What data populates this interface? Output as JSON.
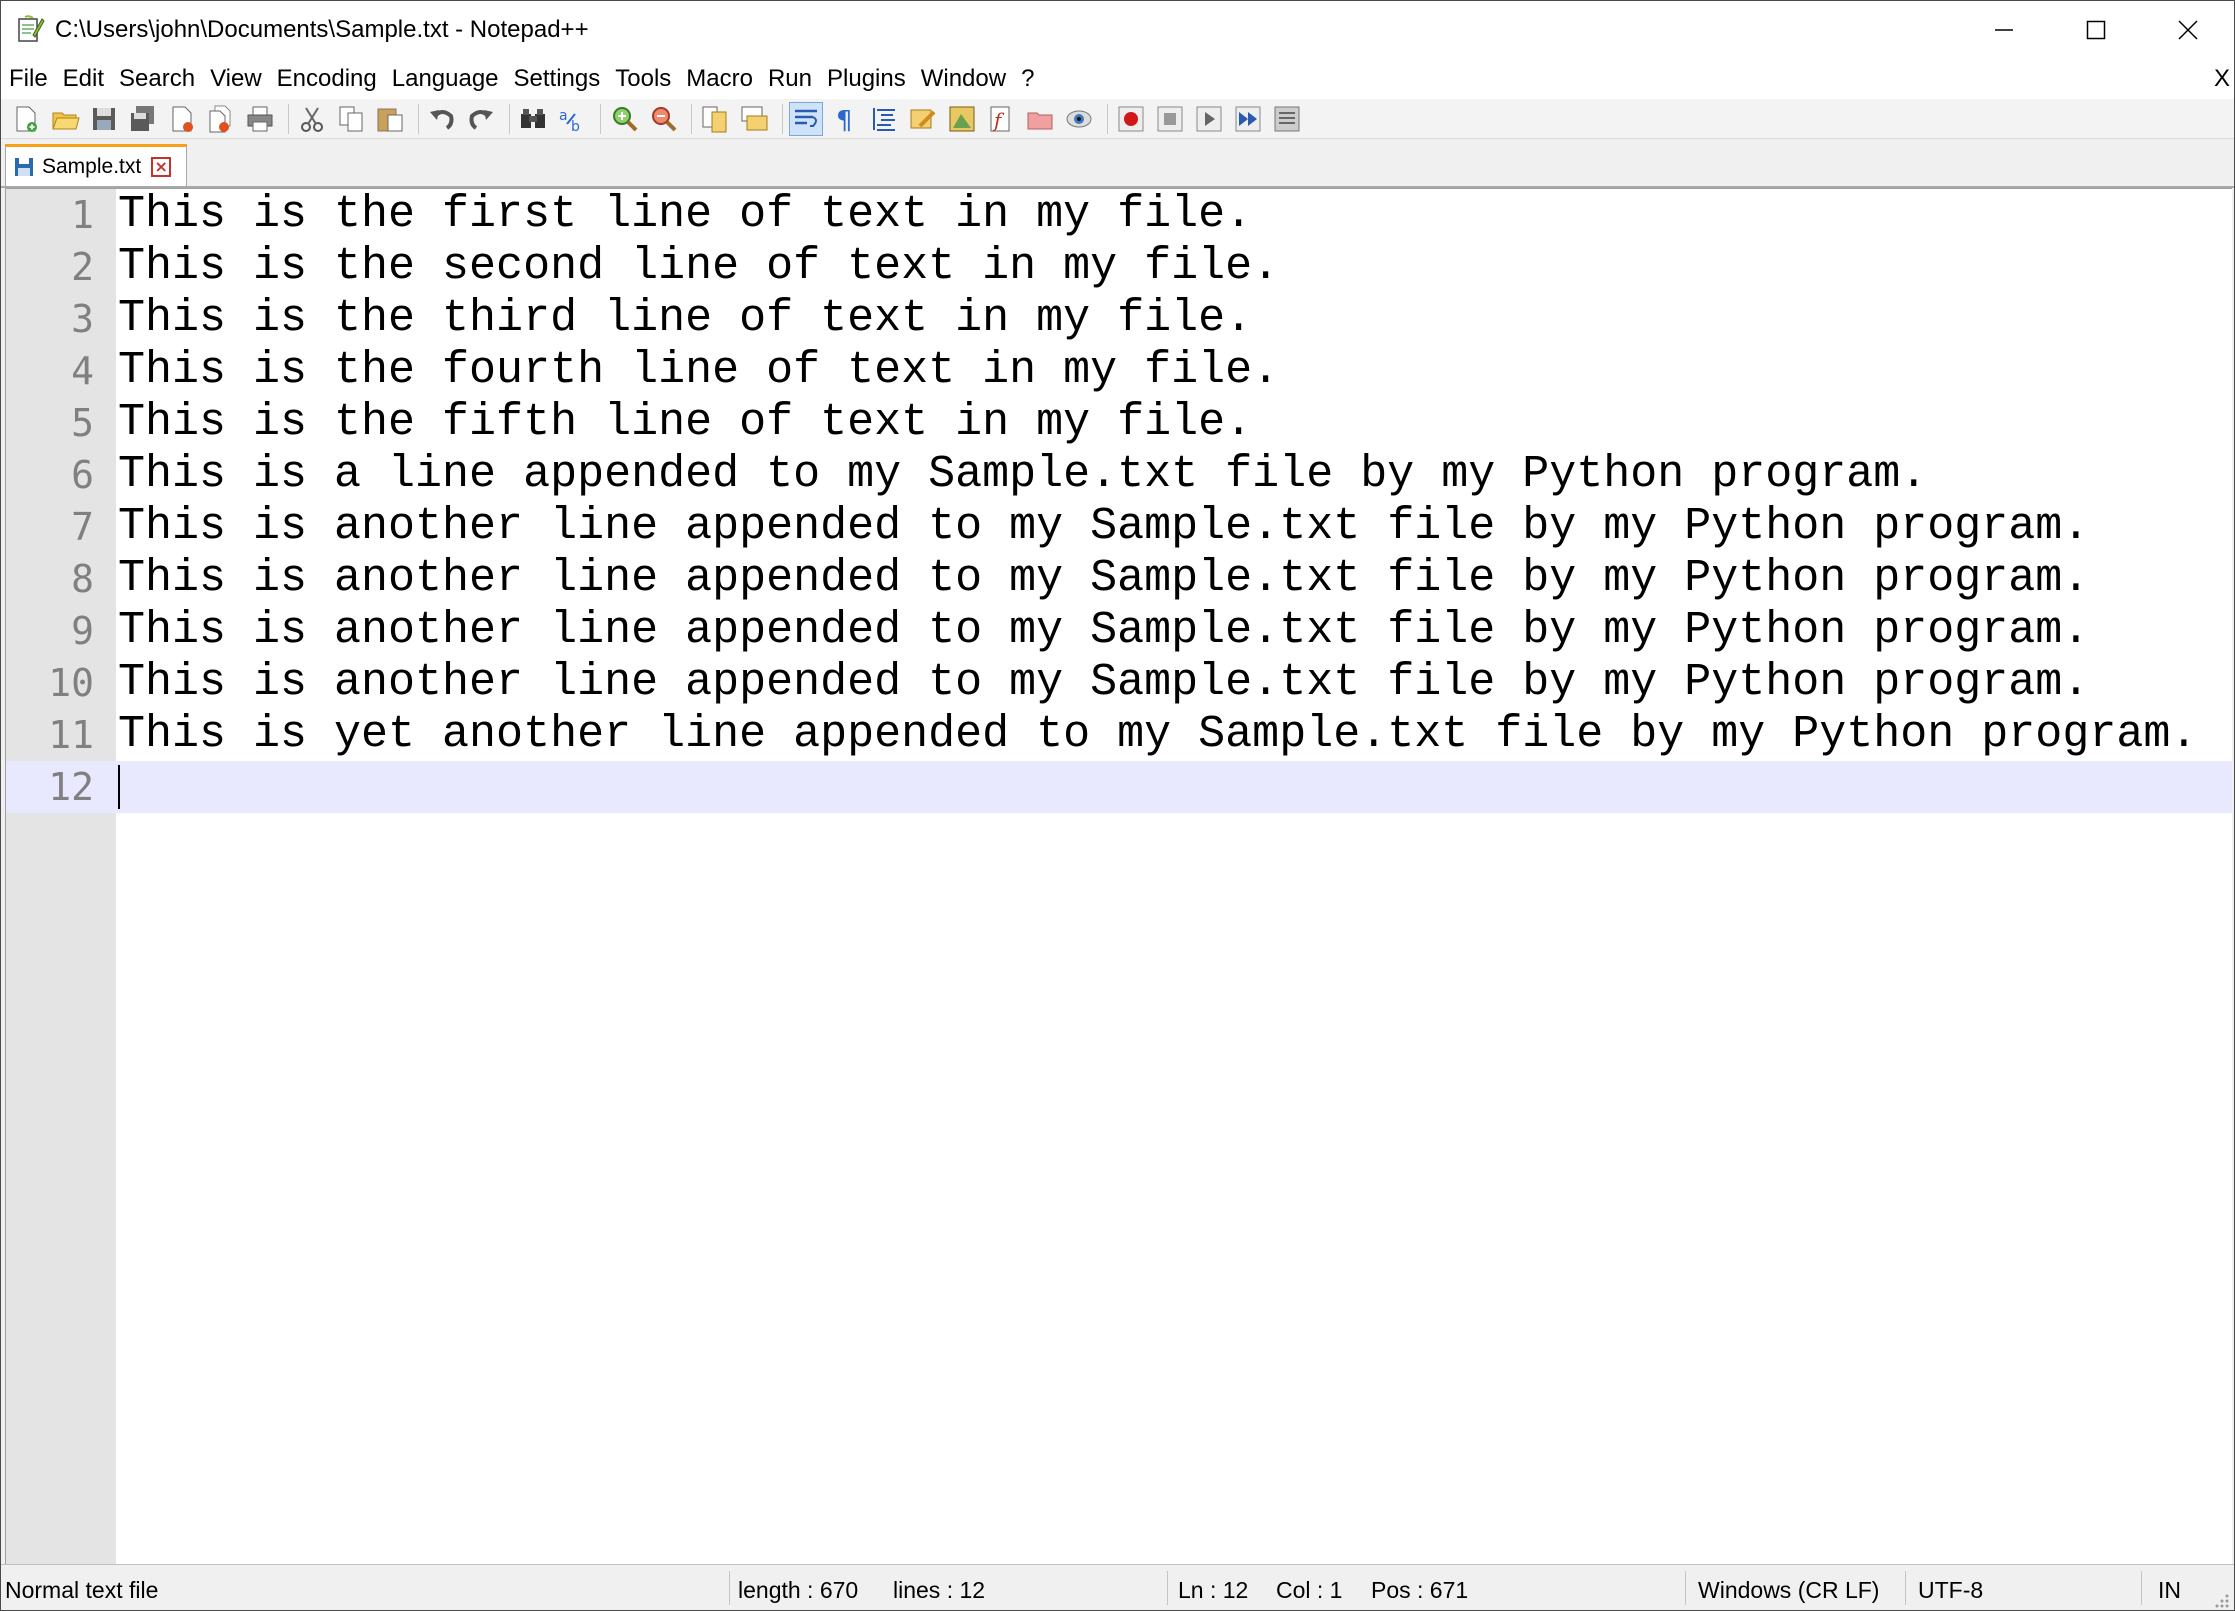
{
  "window": {
    "title": "C:\\Users\\john\\Documents\\Sample.txt - Notepad++"
  },
  "menu": {
    "items": [
      "File",
      "Edit",
      "Search",
      "View",
      "Encoding",
      "Language",
      "Settings",
      "Tools",
      "Macro",
      "Run",
      "Plugins",
      "Window",
      "?"
    ],
    "close_label": "X"
  },
  "toolbar": {
    "icons": [
      "new-file-icon",
      "open-file-icon",
      "save-icon",
      "save-all-icon",
      "close-icon",
      "close-all-icon",
      "print-icon",
      "cut-icon",
      "copy-icon",
      "paste-icon",
      "undo-icon",
      "redo-icon",
      "find-icon",
      "replace-icon",
      "zoom-in-icon",
      "zoom-out-icon",
      "sync-vertical-icon",
      "sync-horizontal-icon",
      "word-wrap-icon",
      "show-all-chars-icon",
      "indent-guide-icon",
      "user-language-icon",
      "doc-map-icon",
      "function-list-icon",
      "folder-workspace-icon",
      "monitoring-icon",
      "record-macro-icon",
      "stop-record-icon",
      "play-macro-icon",
      "run-macro-multiple-icon",
      "save-macro-icon"
    ]
  },
  "tab": {
    "label": "Sample.txt",
    "close_label": "×"
  },
  "editor": {
    "lines": [
      {
        "num": "1",
        "text": "This is the first line of text in my file."
      },
      {
        "num": "2",
        "text": "This is the second line of text in my file."
      },
      {
        "num": "3",
        "text": "This is the third line of text in my file."
      },
      {
        "num": "4",
        "text": "This is the fourth line of text in my file."
      },
      {
        "num": "5",
        "text": "This is the fifth line of text in my file."
      },
      {
        "num": "6",
        "text": "This is a line appended to my Sample.txt file by my Python program."
      },
      {
        "num": "7",
        "text": "This is another line appended to my Sample.txt file by my Python program."
      },
      {
        "num": "8",
        "text": "This is another line appended to my Sample.txt file by my Python program."
      },
      {
        "num": "9",
        "text": "This is another line appended to my Sample.txt file by my Python program."
      },
      {
        "num": "10",
        "text": "This is another line appended to my Sample.txt file by my Python program."
      },
      {
        "num": "11",
        "text": "This is yet another line appended to my Sample.txt file by my Python program."
      },
      {
        "num": "12",
        "text": ""
      }
    ],
    "current_line": 12
  },
  "status": {
    "file_type": "Normal text file",
    "length": "length : 670",
    "lines": "lines : 12",
    "ln": "Ln : 12",
    "col": "Col : 1",
    "pos": "Pos : 671",
    "eol": "Windows (CR LF)",
    "encoding": "UTF-8",
    "mode": "IN"
  },
  "colors": {
    "current_line": "#e8e8ff",
    "gutter": "#e4e4e4",
    "tab_accent": "#f8a018"
  }
}
